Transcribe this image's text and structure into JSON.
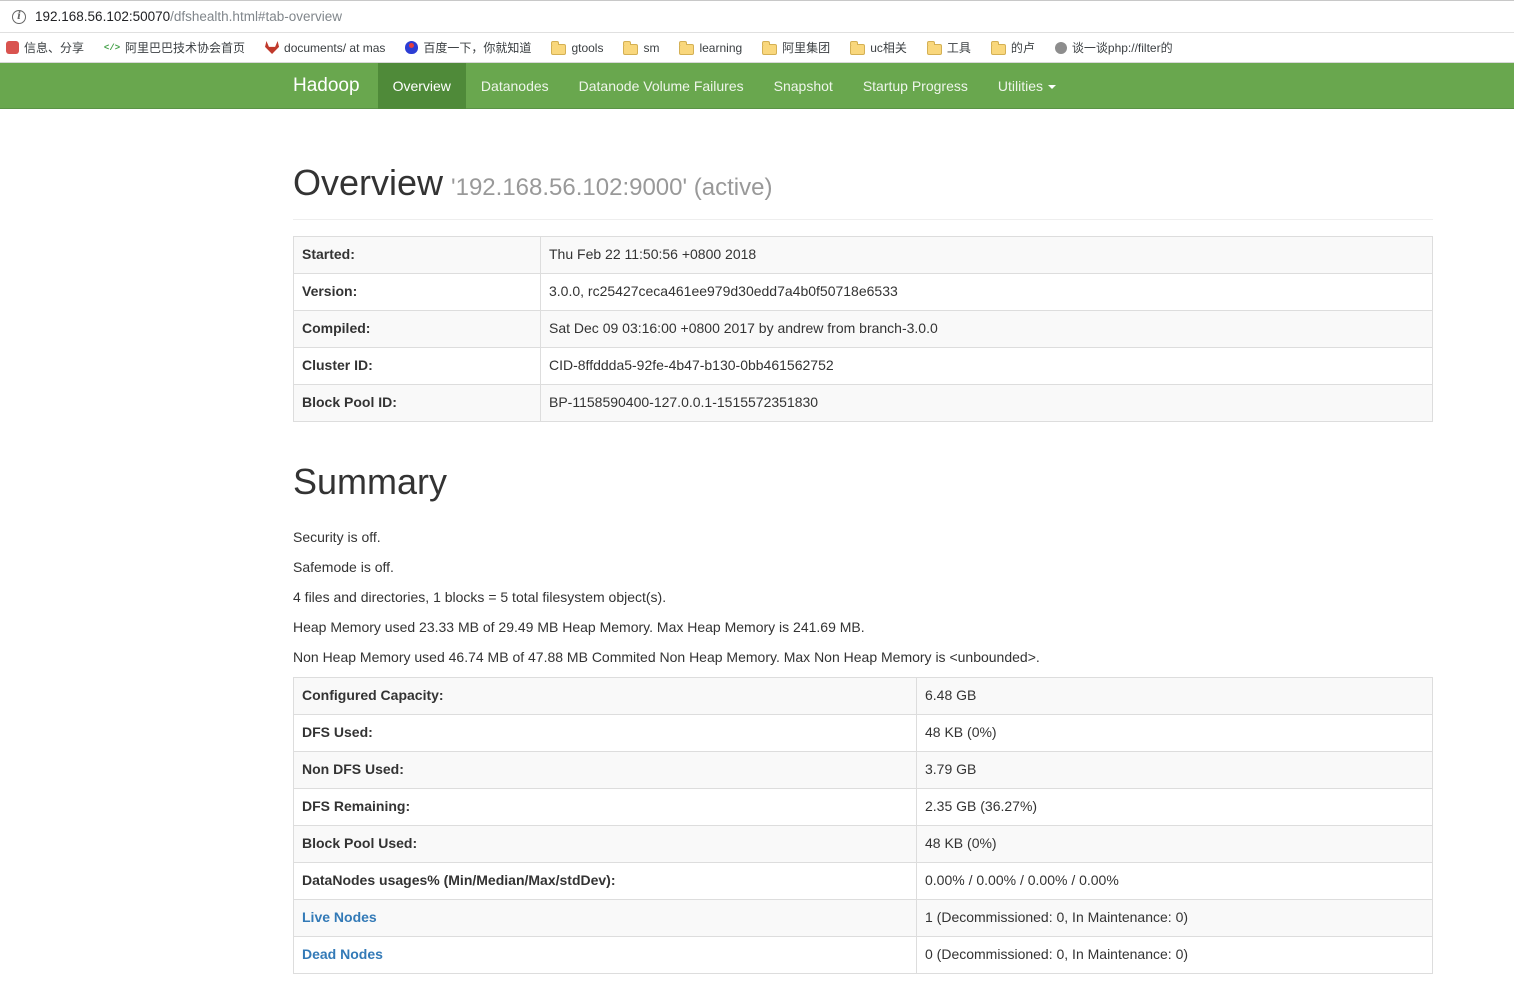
{
  "browser": {
    "url_host": "192.168.56.102:50070",
    "url_path": "/dfshealth.html#tab-overview",
    "bookmarks": [
      {
        "label": "信息、分享",
        "icon": "share"
      },
      {
        "label": "阿里巴巴技术协会首页",
        "icon": "code"
      },
      {
        "label": "documents/ at mas",
        "icon": "gitlab"
      },
      {
        "label": "百度一下，你就知道",
        "icon": "baidu"
      },
      {
        "label": "gtools",
        "icon": "folder"
      },
      {
        "label": "sm",
        "icon": "folder"
      },
      {
        "label": "learning",
        "icon": "folder"
      },
      {
        "label": "阿里集团",
        "icon": "folder"
      },
      {
        "label": "uc相关",
        "icon": "folder"
      },
      {
        "label": "工具",
        "icon": "folder"
      },
      {
        "label": "的卢",
        "icon": "folder"
      },
      {
        "label": "谈一谈php://filter的",
        "icon": "page"
      }
    ]
  },
  "navbar": {
    "brand": "Hadoop",
    "tabs": [
      {
        "label": "Overview",
        "classes": [
          "active"
        ]
      },
      {
        "label": "Datanodes"
      },
      {
        "label": "Datanode Volume Failures"
      },
      {
        "label": "Snapshot"
      },
      {
        "label": "Startup Progress"
      },
      {
        "label": "Utilities",
        "classes": [
          "has-caret"
        ]
      }
    ]
  },
  "overview": {
    "title": "Overview",
    "subtitle": "'192.168.56.102:9000' (active)",
    "rows": [
      {
        "label": "Started:",
        "value": "Thu Feb 22 11:50:56 +0800 2018"
      },
      {
        "label": "Version:",
        "value": "3.0.0, rc25427ceca461ee979d30edd7a4b0f50718e6533"
      },
      {
        "label": "Compiled:",
        "value": "Sat Dec 09 03:16:00 +0800 2017 by andrew from branch-3.0.0"
      },
      {
        "label": "Cluster ID:",
        "value": "CID-8ffddda5-92fe-4b47-b130-0bb461562752"
      },
      {
        "label": "Block Pool ID:",
        "value": "BP-1158590400-127.0.0.1-1515572351830"
      }
    ]
  },
  "summary": {
    "title": "Summary",
    "lines": [
      "Security is off.",
      "Safemode is off.",
      "4 files and directories, 1 blocks = 5 total filesystem object(s).",
      "Heap Memory used 23.33 MB of 29.49 MB Heap Memory. Max Heap Memory is 241.69 MB.",
      "Non Heap Memory used 46.74 MB of 47.88 MB Commited Non Heap Memory. Max Non Heap Memory is <unbounded>."
    ],
    "rows": [
      {
        "label": "Configured Capacity:",
        "value": "6.48 GB"
      },
      {
        "label": "DFS Used:",
        "value": "48 KB (0%)"
      },
      {
        "label": "Non DFS Used:",
        "value": "3.79 GB"
      },
      {
        "label": "DFS Remaining:",
        "value": "2.35 GB (36.27%)"
      },
      {
        "label": "Block Pool Used:",
        "value": "48 KB (0%)"
      },
      {
        "label": "DataNodes usages% (Min/Median/Max/stdDev):",
        "value": "0.00% / 0.00% / 0.00% / 0.00%"
      },
      {
        "label": "Live Nodes",
        "value": "1 (Decommissioned: 0, In Maintenance: 0)",
        "classes": [
          "link-row"
        ]
      },
      {
        "label": "Dead Nodes",
        "value": "0 (Decommissioned: 0, In Maintenance: 0)",
        "classes": [
          "link-row"
        ]
      }
    ]
  }
}
